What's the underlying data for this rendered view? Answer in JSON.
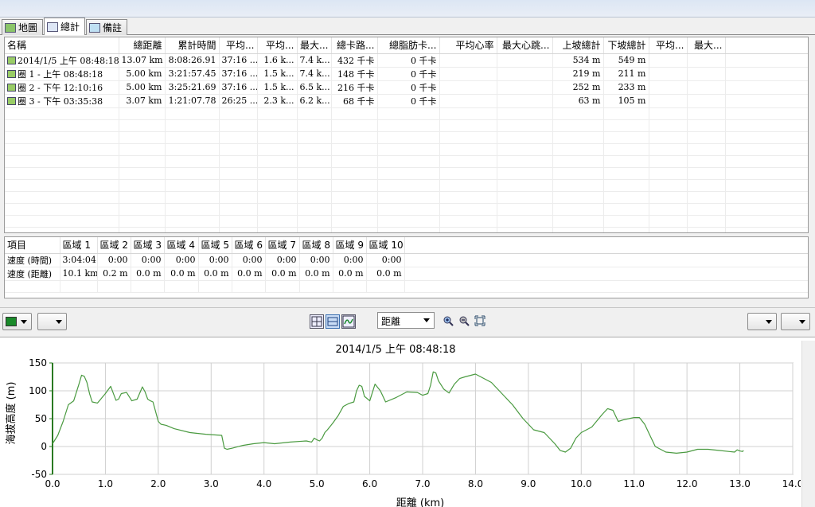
{
  "tabs": [
    {
      "label": "地圖",
      "icon": "map-icon"
    },
    {
      "label": "總計",
      "icon": "table-icon"
    },
    {
      "label": "備註",
      "icon": "note-icon"
    }
  ],
  "laps_table": {
    "columns": [
      "名稱",
      "總距離",
      "累計時間",
      "平均...",
      "平均...",
      "最大...",
      "總卡路...",
      "總脂肪卡...",
      "平均心率",
      "最大心跳...",
      "上坡總計",
      "下坡總計",
      "平均...",
      "最大..."
    ],
    "rows": [
      [
        "2014/1/5 上午 08:48:18",
        "13.07 km",
        "8:08:26.91",
        "37:16 ...",
        "1.6 k...",
        "7.4 k...",
        "432 千卡",
        "0 千卡",
        "",
        "",
        "534 m",
        "549 m",
        "",
        ""
      ],
      [
        "圈 1 - 上午 08:48:18",
        "5.00 km",
        "3:21:57.45",
        "37:16 ...",
        "1.5 k...",
        "7.4 k...",
        "148 千卡",
        "0 千卡",
        "",
        "",
        "219 m",
        "211 m",
        "",
        ""
      ],
      [
        "圈 2 - 下午 12:10:16",
        "5.00 km",
        "3:25:21.69",
        "37:16 ...",
        "1.5 k...",
        "6.5 k...",
        "216 千卡",
        "0 千卡",
        "",
        "",
        "252 m",
        "233 m",
        "",
        ""
      ],
      [
        "圈 3 - 下午 03:35:38",
        "3.07 km",
        "1:21:07.78",
        "26:25 ...",
        "2.3 k...",
        "6.2 k...",
        "68 千卡",
        "0 千卡",
        "",
        "",
        "63 m",
        "105 m",
        "",
        ""
      ]
    ],
    "row_icons": [
      "course-icon",
      "lap-icon",
      "lap-icon",
      "lap-icon"
    ]
  },
  "zones_table": {
    "columns": [
      "項目",
      "區域 1",
      "區域 2",
      "區域 3",
      "區域 4",
      "區域 5",
      "區域 6",
      "區域 7",
      "區域 8",
      "區域 9",
      "區域 10"
    ],
    "rows": [
      [
        "速度 (時間)",
        "3:04:04",
        "0:00",
        "0:00",
        "0:00",
        "0:00",
        "0:00",
        "0:00",
        "0:00",
        "0:00",
        "0:00"
      ],
      [
        "速度 (距離)",
        "10.1 km",
        "0.2 m",
        "0.0 m",
        "0.0 m",
        "0.0 m",
        "0.0 m",
        "0.0 m",
        "0.0 m",
        "0.0 m",
        "0.0 m"
      ]
    ]
  },
  "toolbar": {
    "color_swatch": "#1a8a2a",
    "x_axis_select": "距離",
    "buttons": [
      "split-view-icon",
      "stack-view-icon",
      "line-chart-icon"
    ],
    "zoom_icons": [
      "zoom-in-icon",
      "zoom-out-icon",
      "fit-icon"
    ]
  },
  "chart_data": {
    "type": "line",
    "title": "2014/1/5 上午 08:48:18",
    "xlabel": "距離 (km)",
    "ylabel": "海拔高度 (m)",
    "xlim": [
      0,
      14
    ],
    "ylim": [
      -50,
      150
    ],
    "xticks": [
      "0.0",
      "1.0",
      "2.0",
      "3.0",
      "4.0",
      "5.0",
      "6.0",
      "7.0",
      "8.0",
      "9.0",
      "10.0",
      "11.0",
      "12.0",
      "13.0",
      "14.0"
    ],
    "yticks": [
      "150",
      "100",
      "50",
      "0",
      "-50"
    ],
    "grid": true,
    "line_color": "#4a9a40",
    "axis_color": "#2a7a22",
    "series": [
      {
        "x": [
          0,
          0.1,
          0.2,
          0.3,
          0.4,
          0.5,
          0.55,
          0.6,
          0.65,
          0.7,
          0.75,
          0.85,
          1.0,
          1.1,
          1.2,
          1.25,
          1.3,
          1.4,
          1.5,
          1.6,
          1.7,
          1.75,
          1.8,
          1.85,
          1.9,
          2.0,
          2.05,
          2.15,
          2.3,
          2.6,
          2.9,
          3.2,
          3.25,
          3.3,
          3.4,
          3.6,
          3.8,
          4.0,
          4.2,
          4.5,
          4.8,
          4.9,
          4.95,
          5.0,
          5.05,
          5.1,
          5.15,
          5.2,
          5.3,
          5.4,
          5.5,
          5.6,
          5.7,
          5.75,
          5.8,
          5.85,
          5.9,
          6.0,
          6.1,
          6.2,
          6.3,
          6.5,
          6.7,
          6.9,
          7.0,
          7.1,
          7.15,
          7.2,
          7.25,
          7.3,
          7.4,
          7.5,
          7.6,
          7.7,
          7.8,
          8.0,
          8.1,
          8.3,
          8.5,
          8.7,
          8.9,
          9.0,
          9.1,
          9.3,
          9.5,
          9.6,
          9.7,
          9.8,
          9.9,
          10.0,
          10.2,
          10.4,
          10.5,
          10.6,
          10.7,
          10.8,
          10.9,
          11.0,
          11.1,
          11.2,
          11.3,
          11.4,
          11.6,
          11.8,
          12.0,
          12.2,
          12.4,
          12.6,
          12.8,
          12.9,
          12.95,
          13.0,
          13.05,
          13.07
        ],
        "y": [
          5,
          20,
          45,
          75,
          82,
          112,
          128,
          126,
          115,
          95,
          80,
          78,
          95,
          108,
          83,
          85,
          95,
          97,
          82,
          85,
          107,
          98,
          85,
          82,
          80,
          45,
          40,
          38,
          32,
          25,
          22,
          20,
          -3,
          -5,
          -3,
          2,
          5,
          7,
          5,
          8,
          10,
          8,
          15,
          12,
          10,
          15,
          25,
          30,
          42,
          55,
          72,
          77,
          80,
          100,
          110,
          108,
          90,
          82,
          112,
          100,
          80,
          88,
          98,
          97,
          92,
          95,
          110,
          134,
          132,
          118,
          103,
          96,
          112,
          122,
          125,
          130,
          125,
          115,
          95,
          75,
          50,
          40,
          30,
          25,
          5,
          -7,
          -10,
          -3,
          15,
          25,
          35,
          58,
          68,
          65,
          45,
          48,
          50,
          52,
          52,
          40,
          20,
          0,
          -10,
          -12,
          -10,
          -5,
          -5,
          -7,
          -9,
          -10,
          -6,
          -8,
          -9,
          -7
        ]
      }
    ]
  }
}
